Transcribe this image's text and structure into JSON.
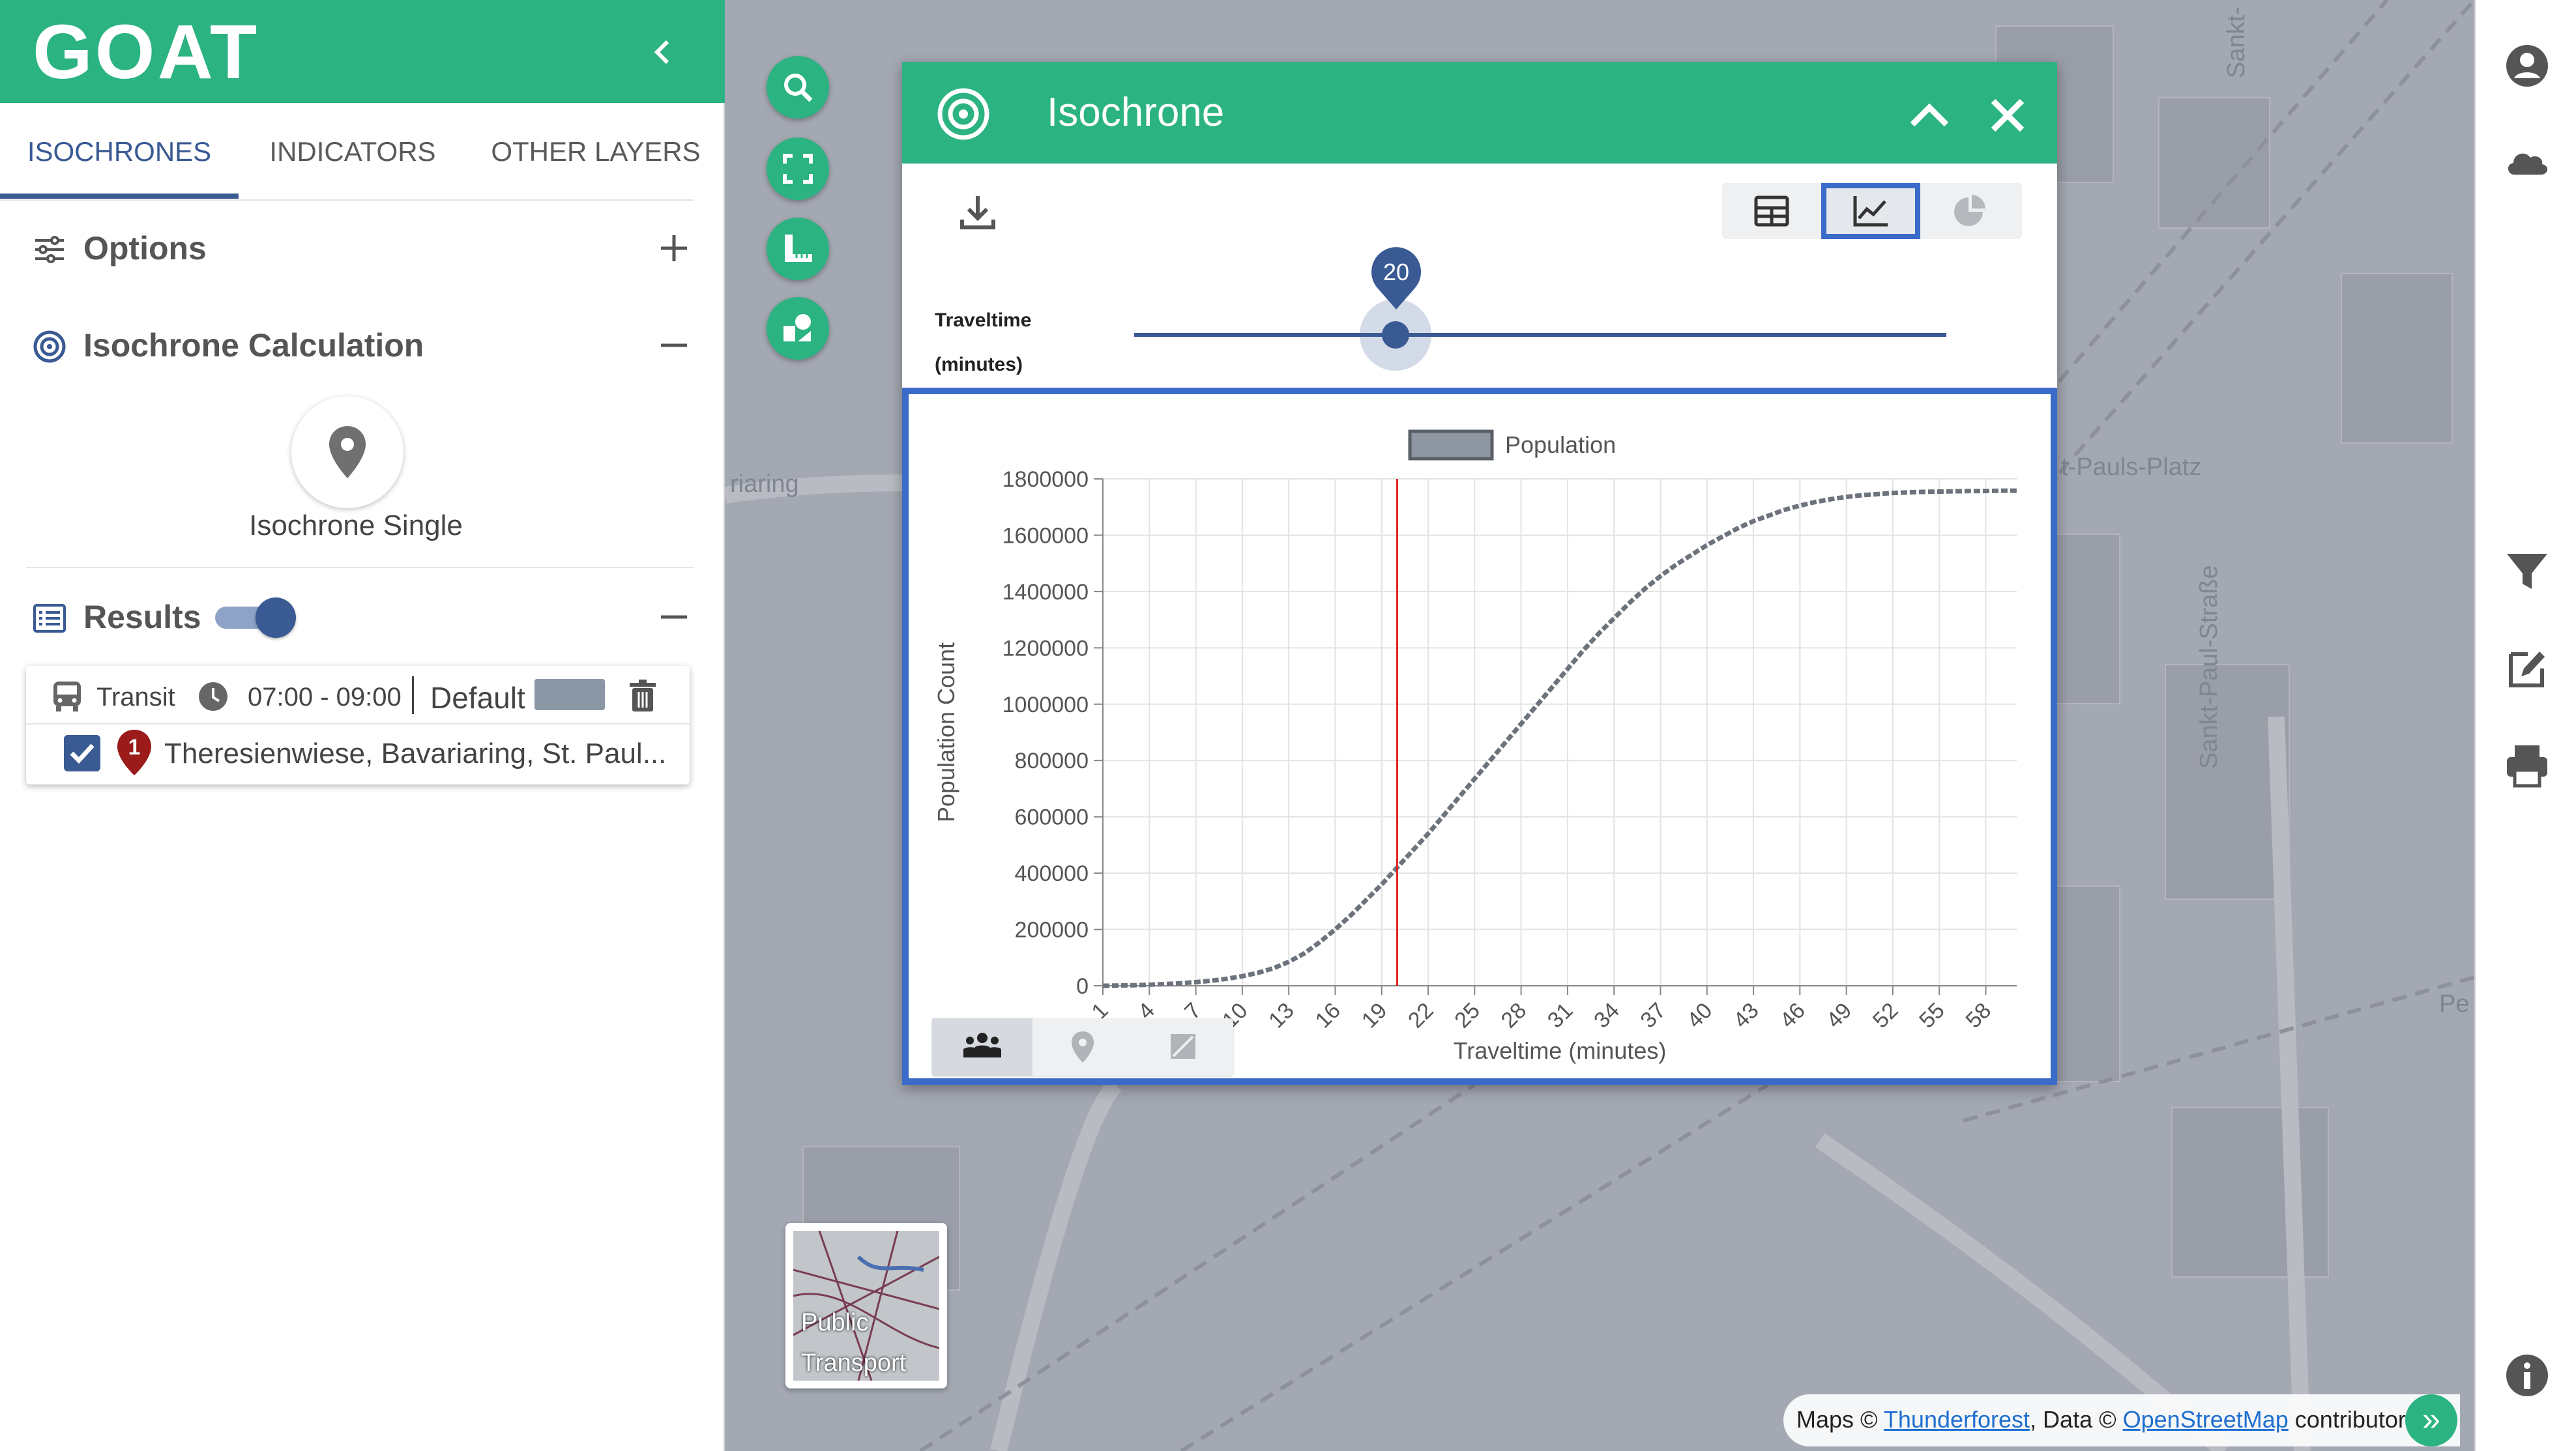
{
  "app": {
    "logo": "GOAT"
  },
  "sidebar": {
    "tabs": [
      {
        "label": "ISOCHRONES",
        "active": true
      },
      {
        "label": "INDICATORS",
        "active": false
      },
      {
        "label": "OTHER LAYERS",
        "active": false
      }
    ],
    "options_label": "Options",
    "calc_label": "Isochrone Calculation",
    "iso_single_label": "Isochrone Single",
    "results_label": "Results",
    "results_toggle_on": true,
    "result": {
      "mode": "Transit",
      "time": "07:00 - 09:00",
      "profile": "Default",
      "marker_number": "1",
      "address": "Theresienwiese, Bavariaring, St. Paul..."
    }
  },
  "map": {
    "labels": [
      "riaring",
      "t-Pauls-Platz",
      "Sankt-Paul-Straße",
      "Sankt-",
      "Pe"
    ]
  },
  "dialog": {
    "title": "Isochrone",
    "slider": {
      "label_line1": "Traveltime",
      "label_line2": "(minutes)",
      "value": "20",
      "min": 1,
      "max": 60
    }
  },
  "basemap": {
    "label": "Public Transport"
  },
  "attribution": {
    "prefix": "Maps © ",
    "link1": "Thunderforest",
    "middle": ", Data © ",
    "link2": "OpenStreetMap",
    "suffix": " contributors"
  },
  "colors": {
    "brand": "#2bb381",
    "accent": "#3a5a94",
    "highlight": "#3a6bc8",
    "marker": "#9b1b1b",
    "cursor_line": "#e02424"
  },
  "chart_data": {
    "type": "line",
    "legend": [
      "Population"
    ],
    "xlabel": "Traveltime (minutes)",
    "ylabel": "Population Count",
    "x_ticks": [
      "1",
      "4",
      "7",
      "10",
      "13",
      "16",
      "19",
      "22",
      "25",
      "28",
      "31",
      "34",
      "37",
      "40",
      "43",
      "46",
      "49",
      "52",
      "55",
      "58"
    ],
    "y_ticks": [
      "0",
      "200000",
      "400000",
      "600000",
      "800000",
      "1000000",
      "1200000",
      "1400000",
      "1600000",
      "1800000"
    ],
    "xlim": [
      1,
      60
    ],
    "ylim": [
      0,
      1800000
    ],
    "grid": true,
    "cursor_x": 20,
    "series": [
      {
        "name": "Population",
        "x": [
          1,
          2,
          3,
          4,
          5,
          6,
          7,
          8,
          9,
          10,
          11,
          12,
          13,
          14,
          15,
          16,
          17,
          18,
          19,
          20,
          21,
          22,
          23,
          24,
          25,
          26,
          27,
          28,
          29,
          30,
          31,
          32,
          33,
          34,
          35,
          36,
          37,
          38,
          39,
          40,
          41,
          42,
          43,
          44,
          45,
          46,
          47,
          48,
          49,
          50,
          51,
          52,
          53,
          54,
          55,
          56,
          57,
          58,
          59,
          60
        ],
        "y": [
          0,
          1000,
          2000,
          4000,
          6000,
          9000,
          13000,
          18000,
          25000,
          34000,
          46000,
          62000,
          85000,
          115000,
          155000,
          200000,
          250000,
          305000,
          360000,
          420000,
          480000,
          540000,
          605000,
          670000,
          735000,
          800000,
          865000,
          930000,
          995000,
          1060000,
          1125000,
          1190000,
          1250000,
          1305000,
          1360000,
          1410000,
          1455000,
          1495000,
          1530000,
          1565000,
          1595000,
          1625000,
          1650000,
          1670000,
          1690000,
          1705000,
          1718000,
          1728000,
          1736000,
          1742000,
          1746000,
          1750000,
          1752000,
          1754000,
          1755000,
          1756000,
          1757000,
          1757000,
          1758000,
          1758000
        ]
      }
    ]
  }
}
